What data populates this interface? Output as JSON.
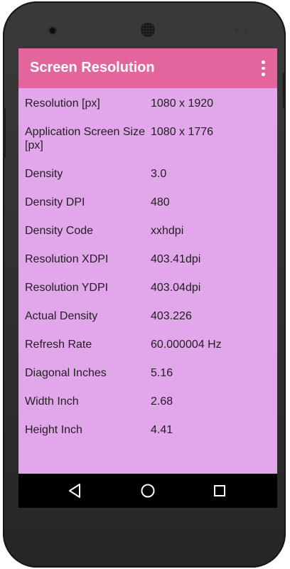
{
  "app": {
    "title": "Screen Resolution",
    "appbar_color": "#e2659d",
    "content_color": "#e2a6ea"
  },
  "rows": [
    {
      "label": "Resolution [px]",
      "value": "1080 x 1920"
    },
    {
      "label": "Application Screen Size [px]",
      "value": "1080 x 1776"
    },
    {
      "label": "Density",
      "value": "3.0"
    },
    {
      "label": "Density DPI",
      "value": "480"
    },
    {
      "label": "Density Code",
      "value": "xxhdpi"
    },
    {
      "label": "Resolution XDPI",
      "value": "403.41dpi"
    },
    {
      "label": "Resolution YDPI",
      "value": "403.04dpi"
    },
    {
      "label": "Actual Density",
      "value": "403.226"
    },
    {
      "label": "Refresh Rate",
      "value": "60.000004 Hz"
    },
    {
      "label": "Diagonal Inches",
      "value": "5.16"
    },
    {
      "label": "Width Inch",
      "value": "2.68"
    },
    {
      "label": "Height Inch",
      "value": "4.41"
    }
  ],
  "icons": {
    "menu": "more-vert-icon",
    "back": "back-triangle-icon",
    "home": "home-circle-icon",
    "recents": "recents-square-icon"
  }
}
